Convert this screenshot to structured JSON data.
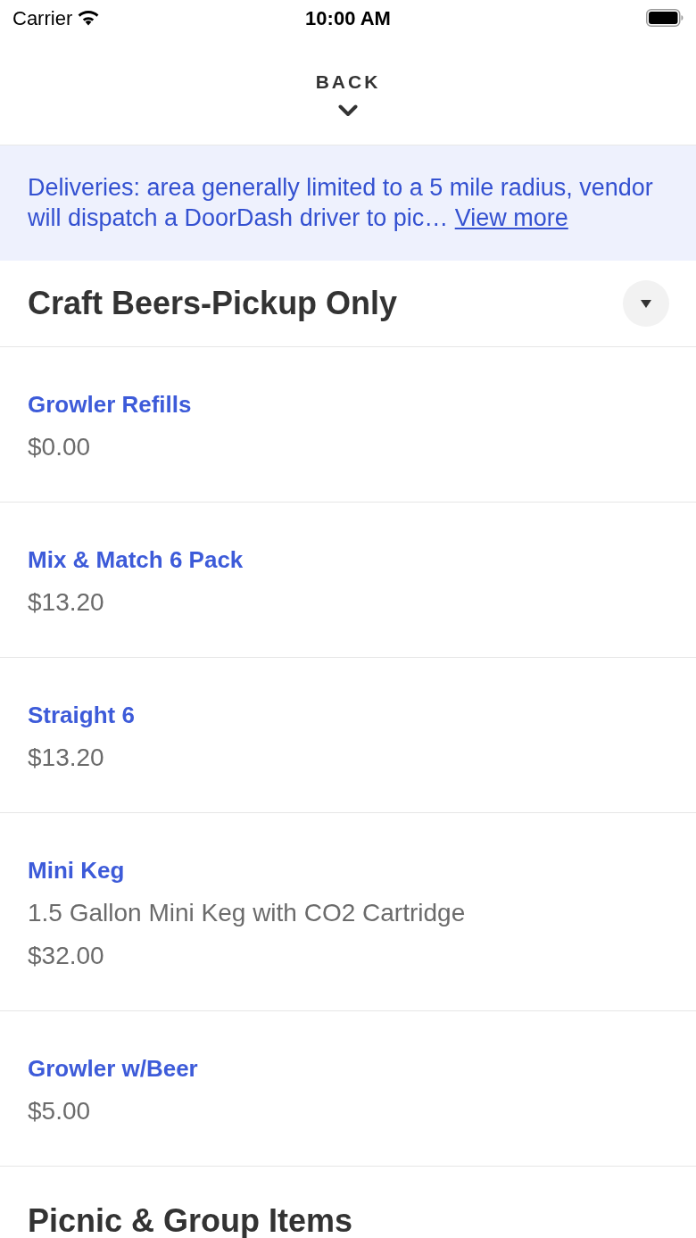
{
  "status_bar": {
    "carrier": "Carrier",
    "time": "10:00 AM"
  },
  "header": {
    "back_label": "BACK"
  },
  "notice": {
    "text": "Deliveries: area generally limited to a 5 mile radius, vendor will dispatch a DoorDash driver to pic…",
    "link": "View more"
  },
  "sections": [
    {
      "title": "Craft Beers-Pickup Only",
      "expanded": true,
      "items": [
        {
          "name": "Growler Refills",
          "price": "$0.00"
        },
        {
          "name": "Mix & Match 6 Pack",
          "price": "$13.20"
        },
        {
          "name": "Straight 6",
          "price": "$13.20"
        },
        {
          "name": "Mini Keg",
          "description": "1.5 Gallon Mini Keg with CO2 Cartridge",
          "price": "$32.00"
        },
        {
          "name": "Growler w/Beer",
          "price": "$5.00"
        }
      ]
    },
    {
      "title": "Picnic & Group Items"
    }
  ]
}
